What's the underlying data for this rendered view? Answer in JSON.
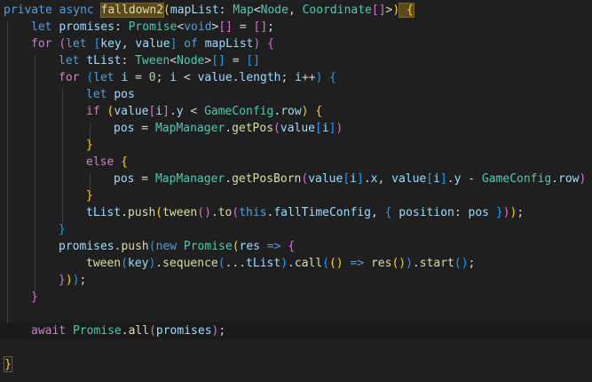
{
  "code": {
    "l1": [
      "private",
      "async",
      "falldown2",
      "(",
      "mapList",
      ": ",
      "Map",
      "<",
      "Node",
      ", ",
      "Coordinate",
      "[]",
      ">",
      ")",
      " {"
    ],
    "l2": [
      "let",
      "promises",
      ": ",
      "Promise",
      "<",
      "void",
      ">",
      "[]",
      " = ",
      "[]",
      ";"
    ],
    "l3": [
      "for",
      "(",
      "let",
      "[",
      "key",
      ", ",
      "value",
      "]",
      "of",
      "mapList",
      ")",
      "{"
    ],
    "l4": [
      "let",
      "tList",
      ": ",
      "Tween",
      "<",
      "Node",
      ">",
      "[]",
      " = ",
      "[]"
    ],
    "l5": [
      "for",
      "(",
      "let",
      "i",
      " = ",
      "0",
      "; ",
      "i",
      " < ",
      "value",
      ".",
      "length",
      "; ",
      "i",
      "++",
      ")",
      "{"
    ],
    "l6": [
      "let",
      "pos"
    ],
    "l7": [
      "if",
      "(",
      "value",
      "[",
      "i",
      "]",
      ".",
      "y",
      " < ",
      "GameConfig",
      ".",
      "row",
      ")",
      "{"
    ],
    "l8": [
      "pos",
      " = ",
      "MapManager",
      ".",
      "getPos",
      "(",
      "value",
      "[",
      "i",
      "]",
      ")"
    ],
    "l9": [
      "}"
    ],
    "l10": [
      "else",
      "{"
    ],
    "l11": [
      "pos",
      " = ",
      "MapManager",
      ".",
      "getPosBorn",
      "(",
      "value",
      "[",
      "i",
      "]",
      ".",
      "x",
      ", ",
      "value",
      "[",
      "i",
      "]",
      ".",
      "y",
      " - ",
      "GameConfig",
      ".",
      "row",
      ")"
    ],
    "l12": [
      "}"
    ],
    "l13": [
      "tList",
      ".",
      "push",
      "(",
      "tween",
      "()",
      ".",
      "to",
      "(",
      "this",
      ".",
      "fallTimeConfig",
      ", ",
      "{",
      " position",
      ": ",
      "pos",
      " }",
      ")",
      ")",
      ";"
    ],
    "l14": [
      "}"
    ],
    "l15": [
      "promises",
      ".",
      "push",
      "(",
      "new",
      "Promise",
      "(",
      "res",
      " => ",
      "{"
    ],
    "l16": [
      "tween",
      "(",
      "key",
      ")",
      ".",
      "sequence",
      "(",
      "...",
      "tList",
      ")",
      ".",
      "call",
      "(",
      "()",
      " => ",
      "res",
      "()",
      ")",
      ".",
      "start",
      "()",
      ";"
    ],
    "l17": [
      "}",
      ")",
      ")",
      ";"
    ],
    "l18": [
      "}"
    ],
    "l19": [],
    "l20": [
      "await",
      "Promise",
      ".",
      "all",
      "(",
      "promises",
      ")",
      ";"
    ],
    "l21": [],
    "l22": [
      "}"
    ]
  },
  "colors": {
    "background": "#1f1f1f",
    "keyword": "#569cd6",
    "control": "#c586c0",
    "function": "#dcdcaa",
    "type": "#4ec9b0",
    "variable": "#9cdcfe",
    "number": "#b5cea8",
    "bracket_level_1": "#ffd700",
    "bracket_level_2": "#da70d6",
    "bracket_level_3": "#179fff"
  }
}
